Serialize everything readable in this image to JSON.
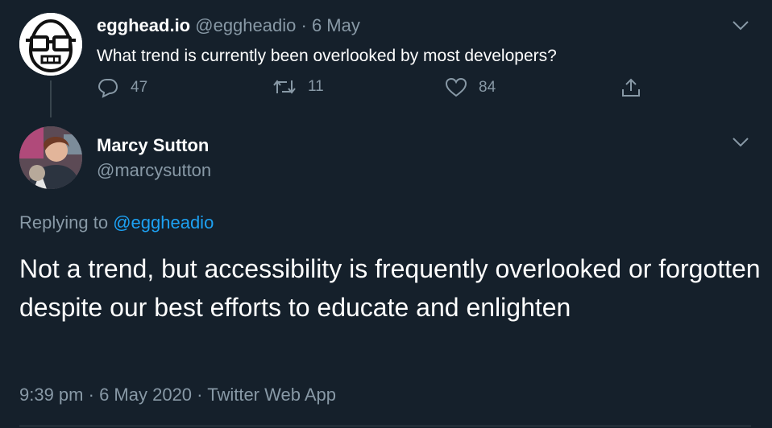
{
  "tweet1": {
    "author_name": "egghead.io",
    "handle": "@eggheadio",
    "separator": "·",
    "date": "6 May",
    "text": "What trend is currently been overlooked by most developers?",
    "actions": {
      "reply_count": "47",
      "retweet_count": "11",
      "like_count": "84"
    },
    "avatar_icon": "egghead-logo-icon"
  },
  "tweet2": {
    "author_name": "Marcy Sutton",
    "handle": "@marcysutton",
    "replying_prefix": "Replying to",
    "replying_handle": "@eggheadio",
    "text": "Not a trend, but accessibility is frequently overlooked or forgotten despite our best efforts to educate and enlighten",
    "time": "9:39 pm",
    "sep1": "·",
    "date": "6 May 2020",
    "sep2": "·",
    "source": "Twitter Web App"
  },
  "colors": {
    "background": "#15202b",
    "muted": "#8899a6",
    "accent": "#1da1f2",
    "divider": "#38444d"
  }
}
